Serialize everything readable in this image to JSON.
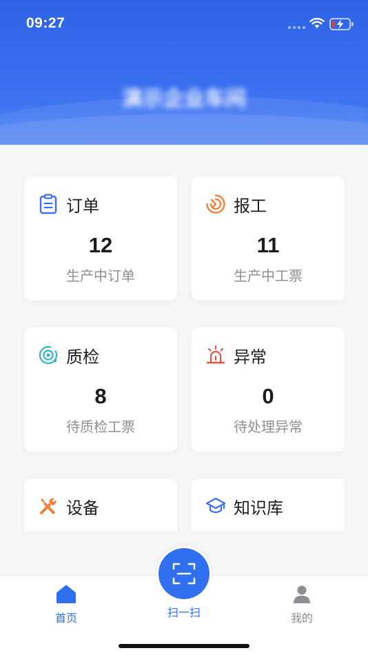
{
  "status_bar": {
    "time": "09:27"
  },
  "header": {
    "title": "演示企业车间"
  },
  "cards": [
    {
      "icon": "clipboard-icon",
      "title": "订单",
      "value": "12",
      "subtitle": "生产中订单",
      "icon_color": "#3d6ef2"
    },
    {
      "icon": "report-icon",
      "title": "报工",
      "value": "11",
      "subtitle": "生产中工票",
      "icon_color": "#f07f3c"
    },
    {
      "icon": "inspection-icon",
      "title": "质检",
      "value": "8",
      "subtitle": "待质检工票",
      "icon_color": "#2fb5c8"
    },
    {
      "icon": "alarm-icon",
      "title": "异常",
      "value": "0",
      "subtitle": "待处理异常",
      "icon_color": "#e8533f"
    },
    {
      "icon": "tools-icon",
      "title": "设备",
      "value": "",
      "subtitle": "",
      "icon_color": "#f07f3c"
    },
    {
      "icon": "graduation-cap-icon",
      "title": "知识库",
      "value": "",
      "subtitle": "",
      "icon_color": "#3d6ef2"
    }
  ],
  "tab_bar": {
    "home_label": "首页",
    "scan_label": "扫一扫",
    "mine_label": "我的",
    "active_color": "#2f6ff0",
    "inactive_color": "#8e8e93"
  }
}
